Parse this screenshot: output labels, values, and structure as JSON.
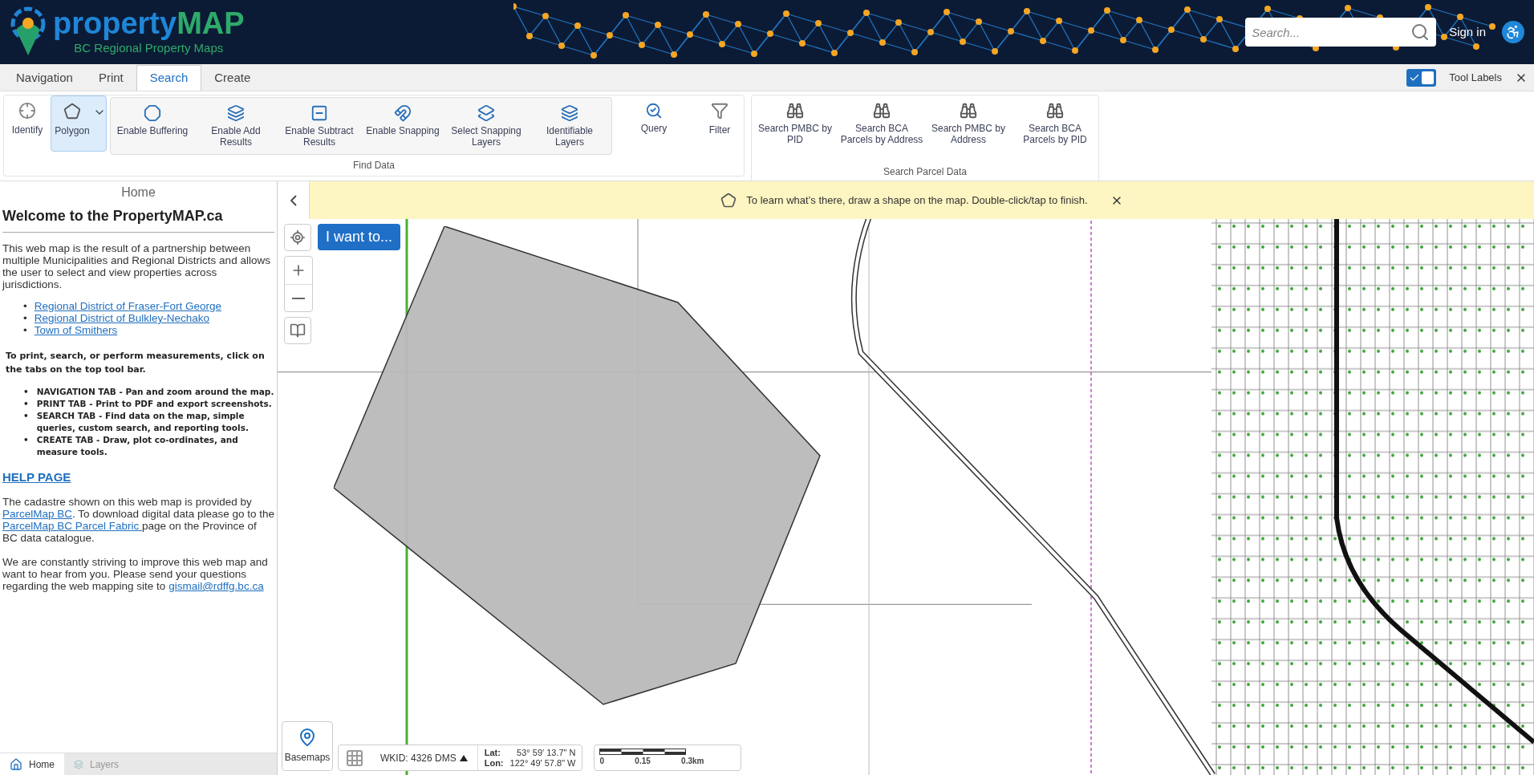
{
  "header": {
    "logo": {
      "title_start": "property",
      "title_end": "MAP",
      "subtitle": "BC Regional Property Maps"
    },
    "search": {
      "placeholder": "Search..."
    },
    "sign_in": "Sign in"
  },
  "tabs": [
    {
      "label": "Navigation",
      "selected": false
    },
    {
      "label": "Print",
      "selected": false
    },
    {
      "label": "Search",
      "selected": true
    },
    {
      "label": "Create",
      "selected": false
    }
  ],
  "tool_labels": {
    "label": "Tool Labels",
    "checked": true
  },
  "find_group": {
    "label": "Find Data",
    "leading": [
      {
        "label": "Identify",
        "selected": false
      },
      {
        "label": "Polygon",
        "selected": true
      }
    ],
    "options": [
      "Enable Buffering",
      "Enable Add Results",
      "Enable Subtract Results",
      "Enable Snapping",
      "Select Snapping Layers",
      "Identifiable Layers"
    ],
    "trailing": [
      "Query",
      "Filter"
    ]
  },
  "parcel_group": {
    "label": "Search Parcel Data",
    "items": [
      "Search PMBC by PID",
      "Search BCA Parcels by Address",
      "Search PMBC by Address",
      "Search BCA Parcels by PID"
    ]
  },
  "sidebar": {
    "title": "Home",
    "heading": "Welcome to the PropertyMAP.ca",
    "intro": "This web map is the result of a partnership between multiple Municipalities and Regional Districts and allows the user to select and view properties across jurisdictions.",
    "links": [
      {
        "marker": "•",
        "text": "Regional District of Fraser-Fort George"
      },
      {
        "marker": "•",
        "text": "Regional District of Bulkley-Nechako"
      },
      {
        "marker": "•",
        "text": "Town of Smithers"
      }
    ],
    "instructions": "To print, search, or perform measurements, click on the tabs on the top tool bar.",
    "bullets": [
      {
        "marker": "•",
        "text": "NAVIGATION TAB - Pan and zoom around the map."
      },
      {
        "marker": "•",
        "text": "PRINT TAB - Print to PDF and export screenshots."
      },
      {
        "marker": "•",
        "text": "SEARCH TAB - Find data on the map, simple queries, custom search, and reporting tools."
      },
      {
        "marker": "•",
        "text": "CREATE TAB - Draw, plot co-ordinates, and measure tools."
      }
    ],
    "help_link": "HELP PAGE",
    "paragraphs": [
      [
        {
          "kind": "text",
          "text": "The cadastre shown on this web map is provided by "
        },
        {
          "kind": "link",
          "text": "ParcelMap BC"
        },
        {
          "kind": "text",
          "text": ".  To download digital data please go to the "
        },
        {
          "kind": "link",
          "text": "ParcelMap BC Parcel Fabric "
        },
        {
          "kind": "text",
          "text": "page on the Province of BC data catalogue."
        }
      ],
      [
        {
          "kind": "text",
          "text": "We are constantly striving to improve this web map and want to hear from you.  Please send your questions regarding the web mapping site to "
        },
        {
          "kind": "link",
          "text": "gismail@rdffg.bc.ca"
        }
      ]
    ],
    "bottom_tabs": [
      {
        "label": "Home",
        "selected": true
      },
      {
        "label": "Layers",
        "selected": false
      }
    ]
  },
  "banner": {
    "text": "To learn what’s there, draw a shape on the map. Double-click/tap to finish."
  },
  "map": {
    "i_want_to": "I want to...",
    "basemaps": "Basemaps",
    "wkid": "WKID: 4326 DMS",
    "lat_label": "Lat:",
    "lat": "53° 59' 13.7\" N",
    "lon_label": "Lon:",
    "lon": "122° 49' 57.8\" W",
    "scale": [
      "0",
      "0.15",
      "0.3km"
    ]
  }
}
